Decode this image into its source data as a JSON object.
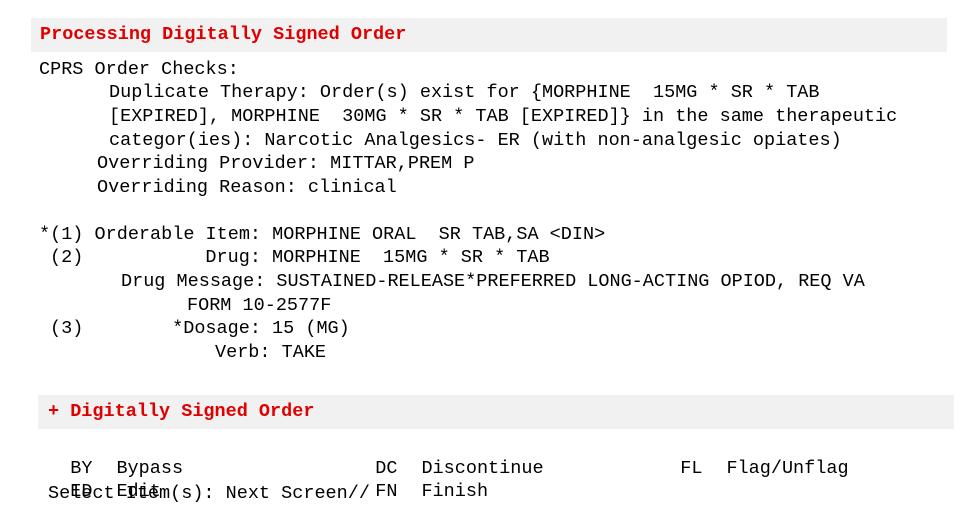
{
  "header": {
    "title": "Processing Digitally Signed Order"
  },
  "order_checks": {
    "heading": "CPRS Order Checks:",
    "message_line1": "Duplicate Therapy: Order(s) exist for {MORPHINE  15MG * SR * TAB",
    "message_line2": "[EXPIRED], MORPHINE  30MG * SR * TAB [EXPIRED]} in the same therapeutic",
    "message_line3": "categor(ies): Narcotic Analgesics- ER (with non-analgesic opiates)",
    "overriding_provider": "Overriding Provider: MITTAR,PREM P",
    "overriding_reason": "Overriding Reason: clinical"
  },
  "order": {
    "item1": "*(1) Orderable Item: MORPHINE ORAL  SR TAB,SA <DIN>",
    "item2": "(2)           Drug: MORPHINE  15MG * SR * TAB",
    "drug_message_line1": "Drug Message: SUSTAINED-RELEASE*PREFERRED LONG-ACTING OPIOD, REQ VA",
    "drug_message_line2": "FORM 10-2577F",
    "item3": "(3)        *Dosage: 15 (MG)",
    "verb": "Verb: TAKE"
  },
  "footer": {
    "title": "+ Digitally Signed Order",
    "actions": [
      {
        "code": "BY",
        "label": "Bypass"
      },
      {
        "code": "DC",
        "label": "Discontinue"
      },
      {
        "code": "FL",
        "label": "Flag/Unflag"
      },
      {
        "code": "ED",
        "label": "Edit"
      },
      {
        "code": "FN",
        "label": "Finish"
      }
    ],
    "prompt": "Select Item(s): Next Screen//"
  }
}
